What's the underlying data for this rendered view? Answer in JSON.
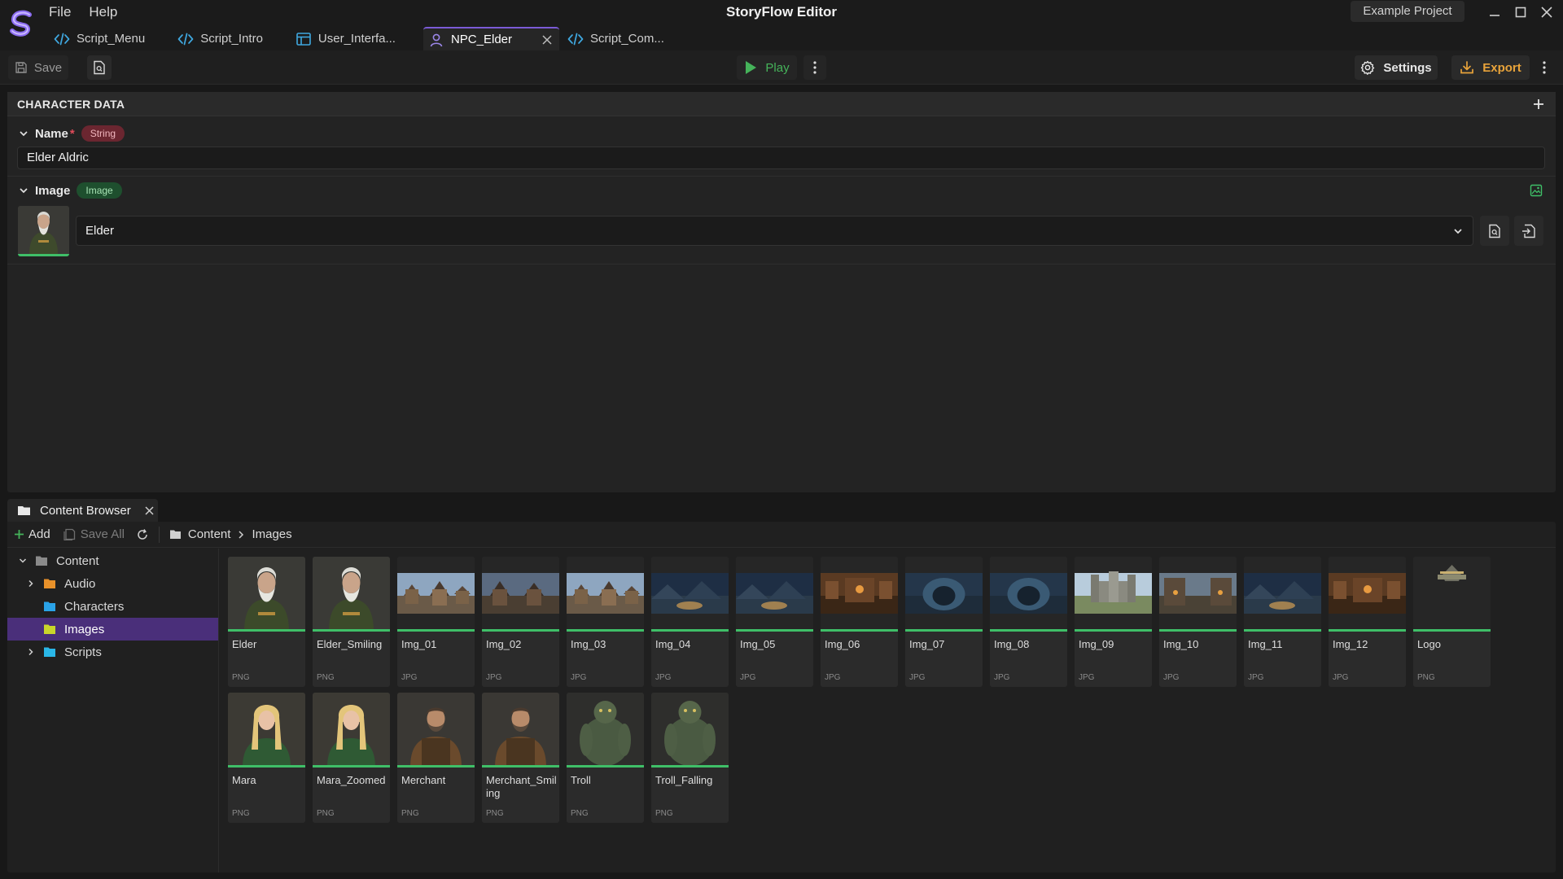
{
  "app": {
    "title": "StoryFlow Editor",
    "project": "Example Project",
    "menu": [
      "File",
      "Help"
    ]
  },
  "tabs": [
    {
      "label": "Script_Menu",
      "icon": "code-icon"
    },
    {
      "label": "Script_Intro",
      "icon": "code-icon"
    },
    {
      "label": "User_Interfa...",
      "icon": "layout-icon"
    },
    {
      "label": "NPC_Elder",
      "icon": "user-icon",
      "active": true
    },
    {
      "label": "Script_Com...",
      "icon": "code-icon"
    }
  ],
  "toolbar": {
    "save_label": "Save",
    "play_label": "Play",
    "settings_label": "Settings",
    "export_label": "Export"
  },
  "character": {
    "header": "CHARACTER DATA",
    "name_field": {
      "label": "Name",
      "required": "*",
      "type": "String",
      "value": "Elder Aldric"
    },
    "image_field": {
      "label": "Image",
      "type": "Image",
      "value": "Elder"
    }
  },
  "content_browser": {
    "tab_label": "Content Browser",
    "add_label": "Add",
    "save_all_label": "Save All",
    "breadcrumb": [
      "Content",
      "Images"
    ],
    "tree": [
      {
        "label": "Content",
        "depth": 0,
        "expanded": true,
        "color": "#8a8a8a"
      },
      {
        "label": "Audio",
        "depth": 1,
        "expanded": false,
        "color": "#e8912a"
      },
      {
        "label": "Characters",
        "depth": 1,
        "leaf": true,
        "color": "#2aa3e8"
      },
      {
        "label": "Images",
        "depth": 1,
        "leaf": true,
        "selected": true,
        "color": "#c9d62a"
      },
      {
        "label": "Scripts",
        "depth": 1,
        "expanded": false,
        "color": "#2ab7e8"
      }
    ],
    "assets": [
      {
        "name": "Elder",
        "type": "PNG",
        "kind": "elder"
      },
      {
        "name": "Elder_Smiling",
        "type": "PNG",
        "kind": "elder"
      },
      {
        "name": "Img_01",
        "type": "JPG",
        "kind": "town"
      },
      {
        "name": "Img_02",
        "type": "JPG",
        "kind": "town-dusk"
      },
      {
        "name": "Img_03",
        "type": "JPG",
        "kind": "town"
      },
      {
        "name": "Img_04",
        "type": "JPG",
        "kind": "night"
      },
      {
        "name": "Img_05",
        "type": "JPG",
        "kind": "night"
      },
      {
        "name": "Img_06",
        "type": "JPG",
        "kind": "tavern"
      },
      {
        "name": "Img_07",
        "type": "JPG",
        "kind": "cave"
      },
      {
        "name": "Img_08",
        "type": "JPG",
        "kind": "cave"
      },
      {
        "name": "Img_09",
        "type": "JPG",
        "kind": "castle"
      },
      {
        "name": "Img_10",
        "type": "JPG",
        "kind": "street"
      },
      {
        "name": "Img_11",
        "type": "JPG",
        "kind": "night"
      },
      {
        "name": "Img_12",
        "type": "JPG",
        "kind": "tavern"
      },
      {
        "name": "Logo",
        "type": "PNG",
        "kind": "logo"
      },
      {
        "name": "Mara",
        "type": "PNG",
        "kind": "mara"
      },
      {
        "name": "Mara_Zoomed",
        "type": "PNG",
        "kind": "mara"
      },
      {
        "name": "Merchant",
        "type": "PNG",
        "kind": "merchant"
      },
      {
        "name": "Merchant_Smiling",
        "type": "PNG",
        "kind": "merchant"
      },
      {
        "name": "Troll",
        "type": "PNG",
        "kind": "troll"
      },
      {
        "name": "Troll_Falling",
        "type": "PNG",
        "kind": "troll"
      }
    ]
  },
  "colors": {
    "accent": "#7b5ad6",
    "play": "#45b35a",
    "export": "#e8a33a",
    "string_badge": "#6b2630",
    "image_badge": "#1e4f2e",
    "asset_underline": "#3fbf68"
  }
}
